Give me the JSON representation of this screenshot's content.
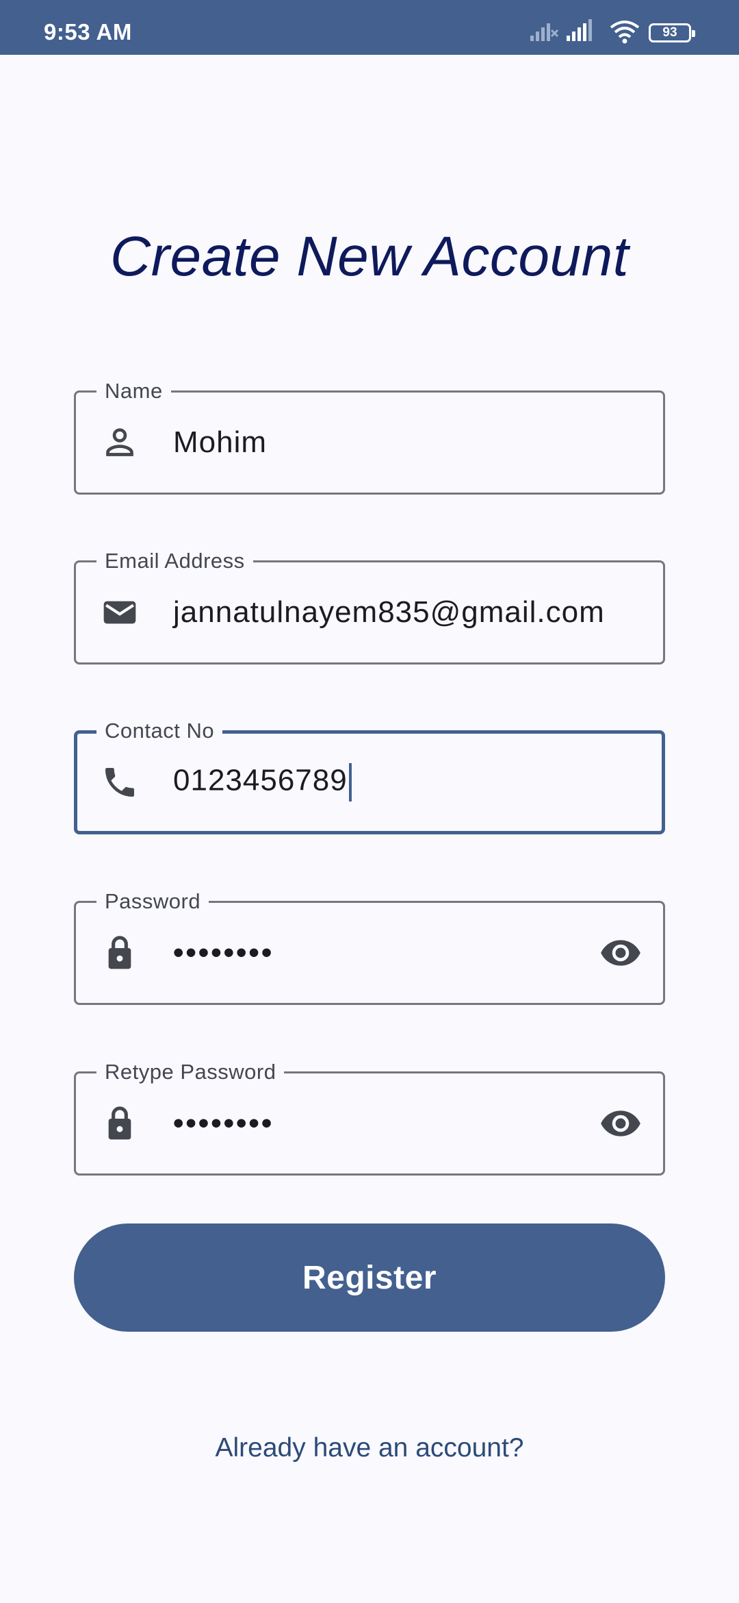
{
  "status_bar": {
    "time": "9:53 AM",
    "battery": "93",
    "icons": [
      "signal-off-icon",
      "signal-icon",
      "wifi-icon",
      "battery-icon"
    ]
  },
  "title": "Create New Account",
  "fields": {
    "name": {
      "label": "Name",
      "value": "Mohim",
      "icon": "person-icon"
    },
    "email": {
      "label": "Email Address",
      "value": "jannatulnayem835@gmail.com",
      "icon": "mail-icon"
    },
    "contact": {
      "label": "Contact No",
      "value": "0123456789",
      "icon": "phone-icon",
      "focused": true
    },
    "password": {
      "label": "Password",
      "value": "••••••••",
      "icon": "lock-icon",
      "toggle_icon": "eye-icon"
    },
    "retype_password": {
      "label": "Retype Password",
      "value": "••••••••",
      "icon": "lock-icon",
      "toggle_icon": "eye-icon"
    }
  },
  "register_button": "Register",
  "login_link": "Already have an account?",
  "colors": {
    "primary": "#43608f",
    "title": "#0e1a5b",
    "background": "#f9f9fe",
    "outline": "#79747e"
  }
}
